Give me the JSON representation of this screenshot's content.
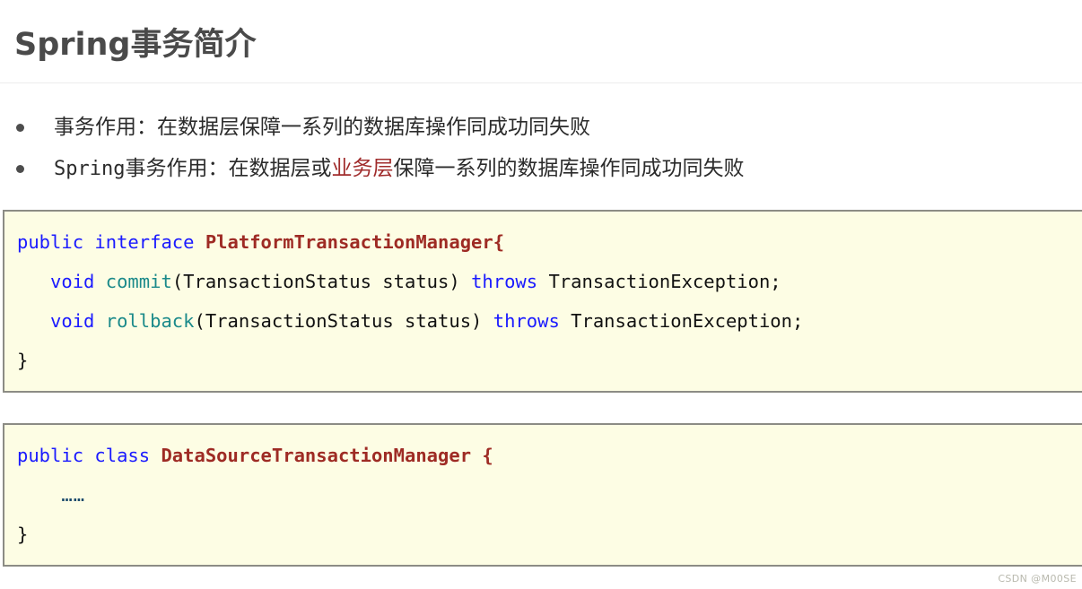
{
  "title": {
    "latin": "Spring",
    "cjk": "事务简介"
  },
  "bullets": [
    {
      "text_plain": "事务作用：在数据层保障一系列的数据库操作同成功同失败",
      "segments": [
        {
          "text": "事务作用：在数据层保障一系列的数据库操作同成功同失败",
          "style": "normal"
        }
      ]
    },
    {
      "text_plain": "Spring事务作用：在数据层或业务层保障一系列的数据库操作同成功同失败",
      "segments": [
        {
          "text": "Spring",
          "style": "mono"
        },
        {
          "text": "事务作用：在数据层或",
          "style": "normal"
        },
        {
          "text": "业务层",
          "style": "red"
        },
        {
          "text": "保障一系列的数据库操作同成功同失败",
          "style": "normal"
        }
      ]
    }
  ],
  "code_blocks": [
    {
      "name": "platform-transaction-manager",
      "lines": [
        {
          "tokens": [
            {
              "t": "public",
              "c": "kw"
            },
            {
              "t": " ",
              "c": "plain"
            },
            {
              "t": "interface",
              "c": "kw"
            },
            {
              "t": " ",
              "c": "plain"
            },
            {
              "t": "PlatformTransactionManager",
              "c": "type"
            },
            {
              "t": "{",
              "c": "brace-red"
            }
          ]
        },
        {
          "tokens": [
            {
              "t": "   ",
              "c": "plain"
            },
            {
              "t": "void",
              "c": "kw"
            },
            {
              "t": " ",
              "c": "plain"
            },
            {
              "t": "commit",
              "c": "meth"
            },
            {
              "t": "(TransactionStatus status) ",
              "c": "plain"
            },
            {
              "t": "throws",
              "c": "kw"
            },
            {
              "t": " TransactionException;",
              "c": "plain"
            }
          ]
        },
        {
          "tokens": [
            {
              "t": "   ",
              "c": "plain"
            },
            {
              "t": "void",
              "c": "kw"
            },
            {
              "t": " ",
              "c": "plain"
            },
            {
              "t": "rollback",
              "c": "meth"
            },
            {
              "t": "(TransactionStatus status) ",
              "c": "plain"
            },
            {
              "t": "throws",
              "c": "kw"
            },
            {
              "t": " TransactionException;",
              "c": "plain"
            }
          ]
        },
        {
          "tokens": [
            {
              "t": "}",
              "c": "plain"
            }
          ]
        }
      ]
    },
    {
      "name": "datasource-transaction-manager",
      "lines": [
        {
          "tokens": [
            {
              "t": "public",
              "c": "kw"
            },
            {
              "t": " ",
              "c": "plain"
            },
            {
              "t": "class",
              "c": "kw"
            },
            {
              "t": " ",
              "c": "plain"
            },
            {
              "t": "DataSourceTransactionManager",
              "c": "type"
            },
            {
              "t": " ",
              "c": "plain"
            },
            {
              "t": "{",
              "c": "brace-red"
            }
          ]
        },
        {
          "tokens": [
            {
              "t": "    ",
              "c": "plain"
            },
            {
              "t": "……",
              "c": "dots"
            }
          ]
        },
        {
          "tokens": [
            {
              "t": "}",
              "c": "plain"
            }
          ]
        }
      ]
    }
  ],
  "watermark": "CSDN @M00SE",
  "colors": {
    "keyword": "#1a1aff",
    "type": "#9e2b24",
    "method": "#1b8a8a",
    "highlight_red": "#a02c2c",
    "code_bg": "#fdfde4",
    "code_border": "#8c8c85",
    "title": "#4a4a4a"
  }
}
